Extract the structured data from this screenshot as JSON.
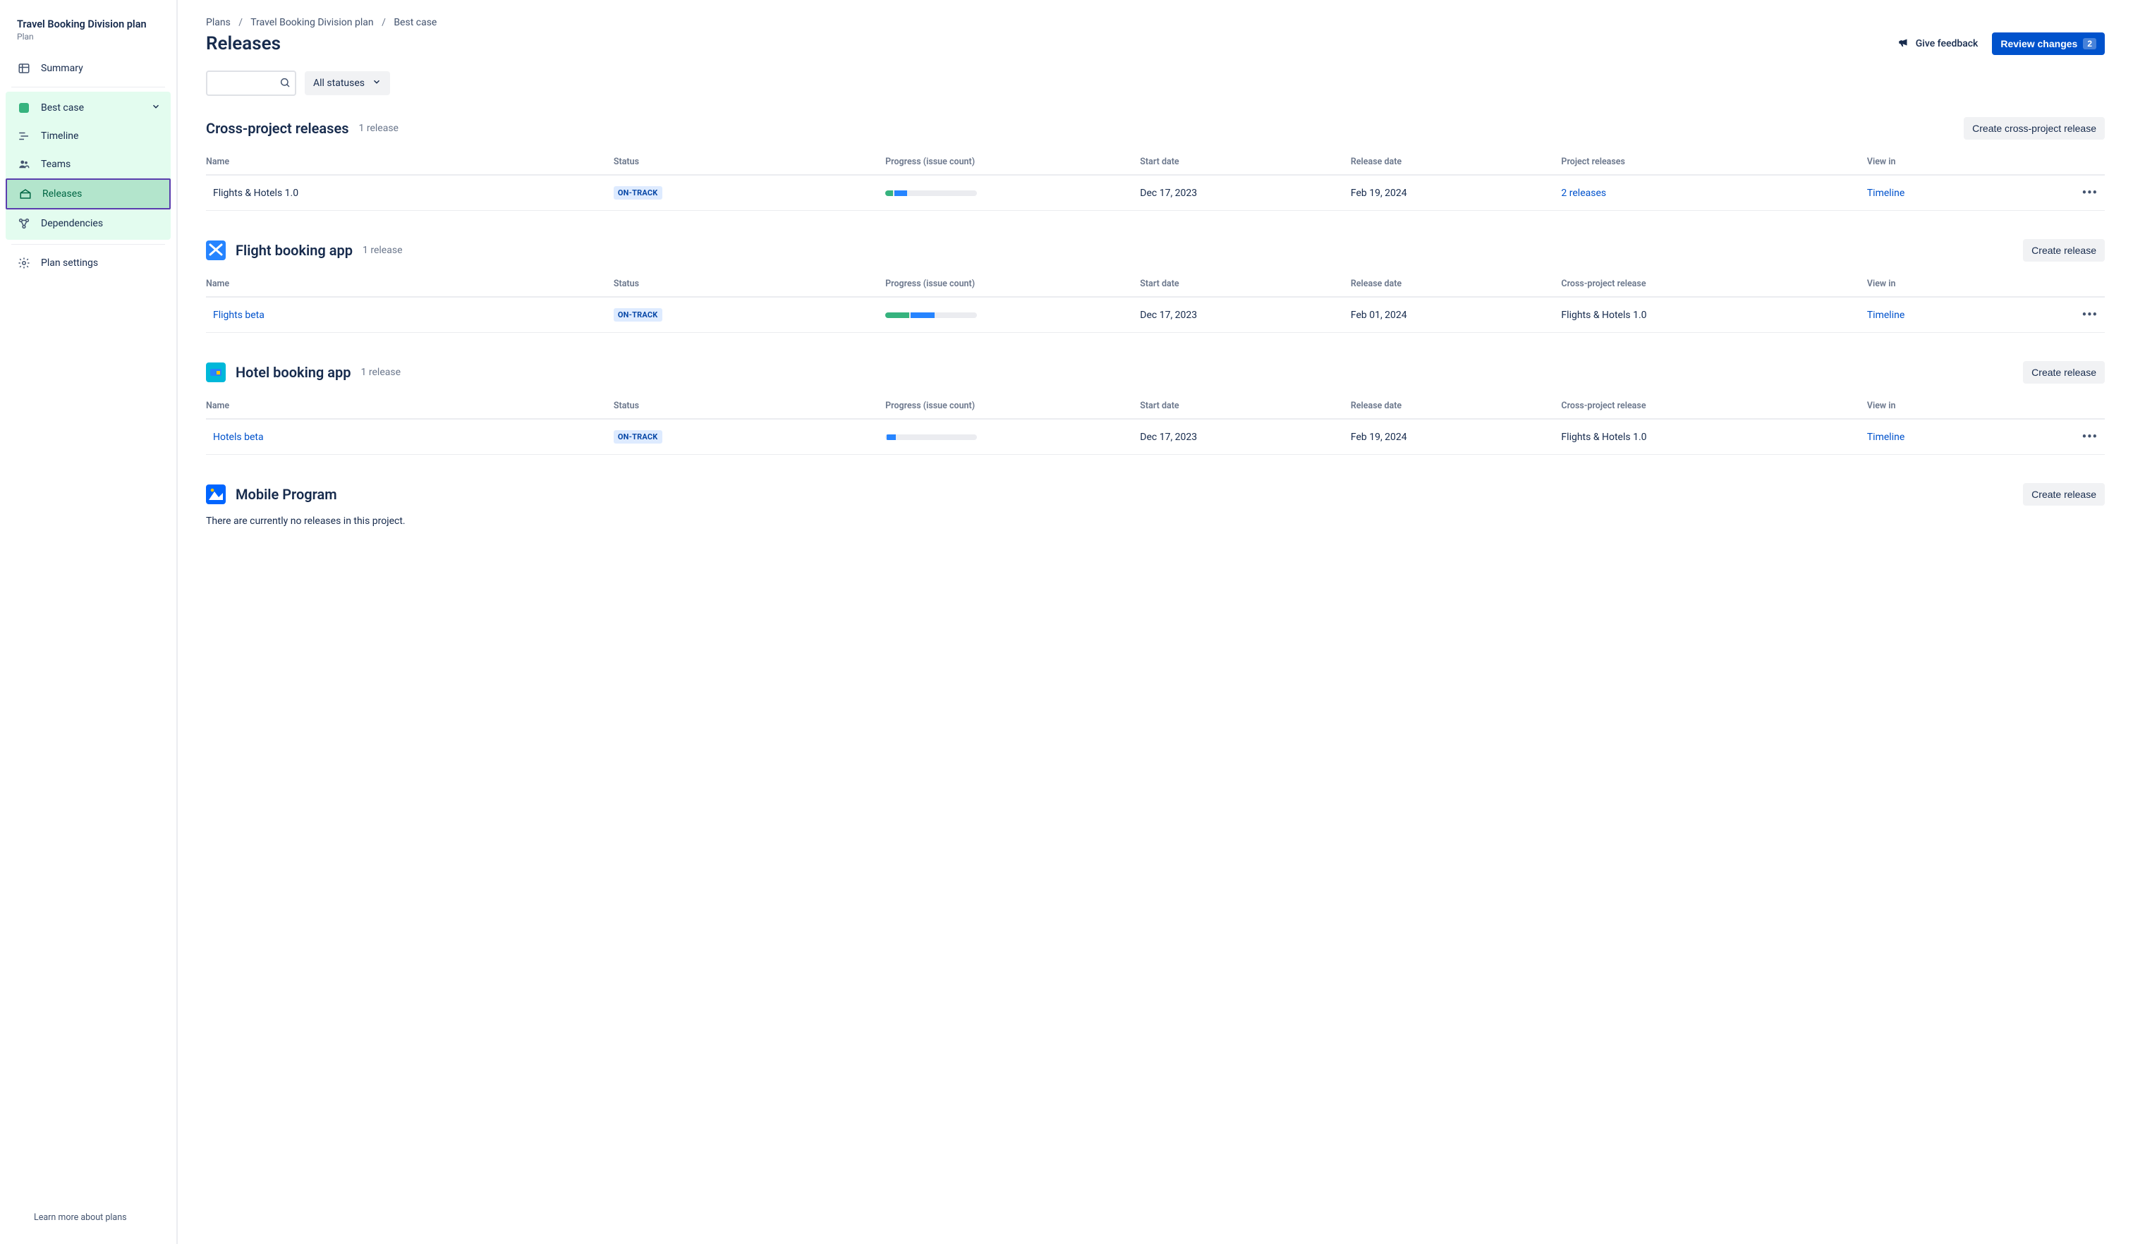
{
  "sidebar": {
    "plan_title": "Travel Booking Division plan",
    "plan_subtitle": "Plan",
    "summary_label": "Summary",
    "scenario_label": "Best case",
    "items": [
      {
        "label": "Timeline"
      },
      {
        "label": "Teams"
      },
      {
        "label": "Releases"
      },
      {
        "label": "Dependencies"
      }
    ],
    "settings_label": "Plan settings",
    "footer_link": "Learn more about plans"
  },
  "breadcrumb": [
    "Plans",
    "Travel Booking Division plan",
    "Best case"
  ],
  "page_title": "Releases",
  "actions": {
    "feedback_label": "Give feedback",
    "review_label": "Review changes",
    "review_count": "2"
  },
  "toolbar": {
    "search_placeholder": "",
    "status_filter_label": "All statuses"
  },
  "columns": {
    "name": "Name",
    "status": "Status",
    "progress": "Progress (issue count)",
    "start": "Start date",
    "release": "Release date",
    "project_releases": "Project releases",
    "cross_project_release": "Cross-project release",
    "view_in": "View in"
  },
  "sections": [
    {
      "key": "cross",
      "title": "Cross-project releases",
      "count": "1 release",
      "create_label": "Create cross-project release",
      "project_col_key": "project_releases",
      "has_icon": false,
      "rows": [
        {
          "name": "Flights & Hotels 1.0",
          "name_link": false,
          "status": "ON-TRACK",
          "progress": {
            "seg1": 8,
            "seg2": 14
          },
          "start": "Dec 17, 2023",
          "release": "Feb 19, 2024",
          "project": "2 releases",
          "project_link": true,
          "view_in": "Timeline"
        }
      ]
    },
    {
      "key": "flight",
      "title": "Flight booking app",
      "count": "1 release",
      "create_label": "Create release",
      "project_col_key": "cross_project_release",
      "has_icon": true,
      "icon_bg": "#2684FF",
      "rows": [
        {
          "name": "Flights beta",
          "name_link": true,
          "status": "ON-TRACK",
          "progress": {
            "seg1": 26,
            "seg2": 26
          },
          "start": "Dec 17, 2023",
          "release": "Feb 01, 2024",
          "project": "Flights & Hotels 1.0",
          "project_link": false,
          "view_in": "Timeline"
        }
      ]
    },
    {
      "key": "hotel",
      "title": "Hotel booking app",
      "count": "1 release",
      "create_label": "Create release",
      "project_col_key": "cross_project_release",
      "has_icon": true,
      "icon_bg": "#00B8D9",
      "rows": [
        {
          "name": "Hotels beta",
          "name_link": true,
          "status": "ON-TRACK",
          "progress": {
            "seg1": 0,
            "seg2": 10
          },
          "start": "Dec 17, 2023",
          "release": "Feb 19, 2024",
          "project": "Flights & Hotels 1.0",
          "project_link": false,
          "view_in": "Timeline"
        }
      ]
    },
    {
      "key": "mobile",
      "title": "Mobile Program",
      "count": "",
      "create_label": "Create release",
      "project_col_key": "cross_project_release",
      "has_icon": true,
      "icon_bg": "#0065FF",
      "empty_message": "There are currently no releases in this project.",
      "rows": []
    }
  ]
}
